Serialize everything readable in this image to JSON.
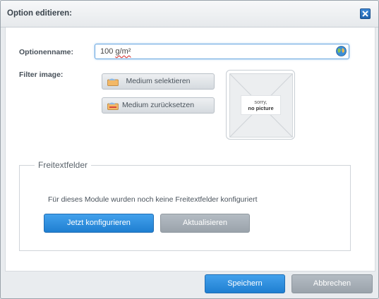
{
  "dialog": {
    "title": "Option editieren:",
    "close_icon": "close-icon"
  },
  "form": {
    "name_label": "Optionenname:",
    "name_value_plain": "100 ",
    "name_value_unit": "g/m²",
    "globe_icon": "globe-icon",
    "filter_image_label": "Filter image:",
    "select_media_label": "Medium selektieren",
    "reset_media_label": "Medium zurücksetzen",
    "preview_line1": "sorry,",
    "preview_line2": "no picture"
  },
  "freitext": {
    "legend": "Freitextfelder",
    "message": "Für dieses Module wurden noch keine Freitextfelder konfiguriert",
    "configure_label": "Jetzt konfigurieren",
    "refresh_label": "Aktualisieren"
  },
  "footer": {
    "save_label": "Speichern",
    "cancel_label": "Abbrechen"
  },
  "colors": {
    "primary": "#2e8fe0",
    "secondary": "#a7afb6"
  }
}
